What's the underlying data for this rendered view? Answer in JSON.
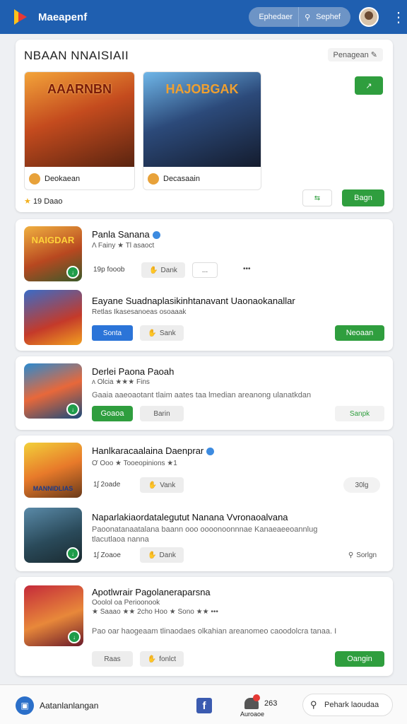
{
  "header": {
    "app_title": "Maeapenf",
    "pill_left": "Ephedaer",
    "pill_right": "Sephef"
  },
  "featured": {
    "title": "NBAAN NNAISIAII",
    "tag": "Penagean",
    "tile1": {
      "art_title": "AAARNBN",
      "footer": "Deokaean"
    },
    "tile2": {
      "art_title": "HAJOBGAK",
      "footer": "Decasaain"
    },
    "rating": "19 Daao",
    "action_green": "Bagn"
  },
  "list1": {
    "row1": {
      "icon_title": "NAIGDAR",
      "title": "Panla Sanana",
      "meta": "Λ Fainy ★ Tl asaoct",
      "count": "19p fooob",
      "btn1": "Dank",
      "btn2": "...",
      "more": "•••"
    },
    "row2": {
      "title": "Eayane Suadnaplasikinhtanavant Uaonaokanallar",
      "meta": "Retlas Ikasesanoeas osoaaak",
      "btn_blue": "Sonta",
      "btn_gray": "Sank",
      "btn_green": "Neoaan"
    }
  },
  "list2": {
    "row": {
      "title": "Derlei Paona Paoah",
      "meta": "ʌ Olcia ★★★ Fins",
      "desc": "Gaaia aaeoaotant tlaim aates taa lmedian areanong ulanatkdan",
      "btn_green": "Goaoa",
      "btn_outline": "Barin",
      "btn_right": "Sanpk"
    }
  },
  "list3": {
    "row1": {
      "icon_title": "MANNIDLIAS",
      "title": "Hanlkaracaalaina Daenprar",
      "meta": "Ơ Ooo ★ Tooeopinions ★1",
      "count": "1ʃ 2oade",
      "btn_gray": "Vank",
      "right": "30lg"
    },
    "row2": {
      "title": "Naparlakiaordatalegutut Nanana Vvronaoalvana",
      "desc": "Paoonatanaatalana baann ooo oooonoonnnae Kanaeaeeoannlug tlacutlaoa nanna",
      "count": "1ʃ Zoaoe",
      "btn_gray": "Dank",
      "right": "Sorlgn"
    }
  },
  "list4": {
    "row": {
      "title": "Apotlwrair Pagolaneraparsna",
      "meta1": "Ooolol oa Perioonook",
      "meta2": "★ Saaao ★★ 2cho Hoo ★ Sono ★★ •••",
      "desc": "Pao oar haogeaam tlinaodaes olkahian areanomeo caoodolcra tanaa. I",
      "btn_gray": "Raas",
      "btn_gray2": "fonlct",
      "btn_green": "Oangin"
    }
  },
  "bottom": {
    "left_label": "Aatanlanlangan",
    "mid_count": "263",
    "mid_label": "Auroaoe",
    "search_label": "Pehark laoudaa"
  },
  "colors": {
    "header_blue": "#1f5fb0",
    "accent_green": "#2f9e3e",
    "accent_blue": "#2b74d8"
  }
}
